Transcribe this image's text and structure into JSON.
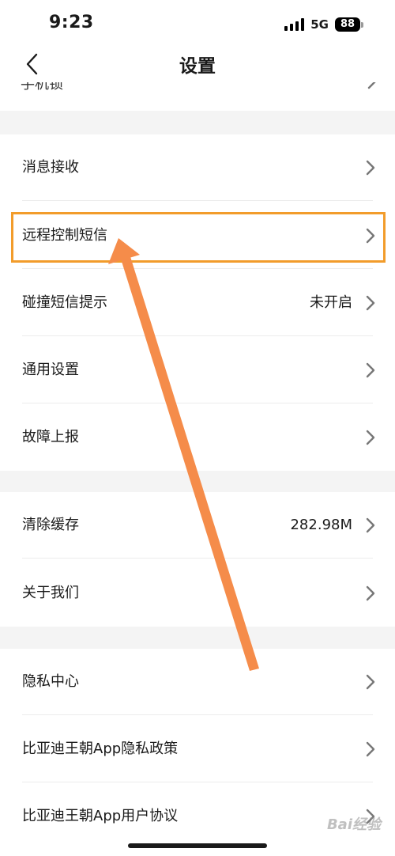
{
  "status_bar": {
    "time": "9:23",
    "network": "5G",
    "battery": "88"
  },
  "nav": {
    "title": "设置"
  },
  "sections": {
    "top_partial": {
      "label": "手机锁"
    },
    "s1": [
      {
        "label": "消息接收",
        "value": ""
      },
      {
        "label": "远程控制短信",
        "value": ""
      },
      {
        "label": "碰撞短信提示",
        "value": "未开启"
      },
      {
        "label": "通用设置",
        "value": ""
      },
      {
        "label": "故障上报",
        "value": ""
      }
    ],
    "s2": [
      {
        "label": "清除缓存",
        "value": "282.98M"
      },
      {
        "label": "关于我们",
        "value": ""
      }
    ],
    "s3": [
      {
        "label": "隐私中心",
        "value": ""
      },
      {
        "label": "比亚迪王朝App隐私政策",
        "value": ""
      },
      {
        "label": "比亚迪王朝App用户协议",
        "value": ""
      }
    ]
  },
  "watermark": "Bai经验",
  "colors": {
    "highlight": "#f29c2b",
    "arrow": "#f58c4a",
    "section_gap": "#f4f4f4"
  }
}
